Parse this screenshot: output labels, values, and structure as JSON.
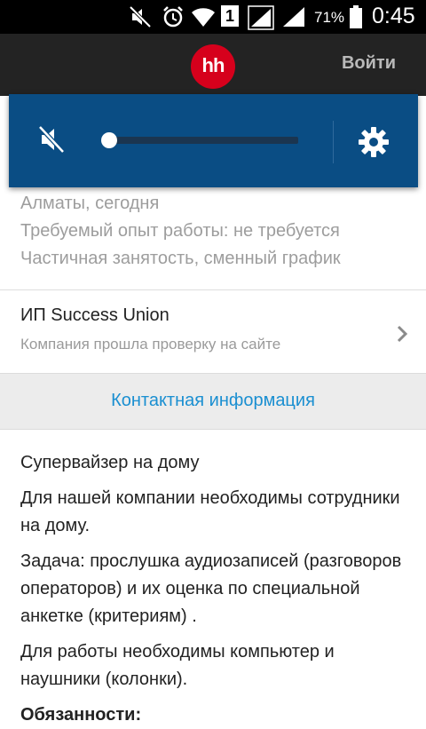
{
  "status_bar": {
    "sim_slot": "1",
    "battery_percent": "71%",
    "time": "0:45",
    "icons": [
      "mute-icon",
      "alarm-clock-icon",
      "wifi-icon",
      "sim-icon",
      "signal-icon",
      "signal-icon",
      "battery-icon"
    ]
  },
  "app_bar": {
    "logo_text": "hh",
    "login_label": "Войти",
    "logo_color": "#d6001c"
  },
  "volume_panel": {
    "level": 0,
    "icons": [
      "speaker-muted-icon",
      "gear-icon"
    ],
    "accent": "#0a4d84"
  },
  "vacancy": {
    "details": [
      "Алматы, сегодня",
      "Требуемый опыт работы: не требуется",
      "Частичная занятость, сменный график"
    ],
    "company": {
      "name": "ИП Success Union",
      "status": "Компания прошла проверку на сайте"
    },
    "contact_info_label": "Контактная информация",
    "link_color": "#1a8fd1",
    "description": [
      "Супервайзер на дому",
      "Для нашей компании необходимы сотрудники на дому.",
      "Задача: прослушка аудиозаписей (разговоров операторов) и их оценка по специальной анкетке (критериям) .",
      "Для работы необходимы компьютер и наушники (колонки)."
    ],
    "responsibilities_heading": "Обязанности:"
  }
}
